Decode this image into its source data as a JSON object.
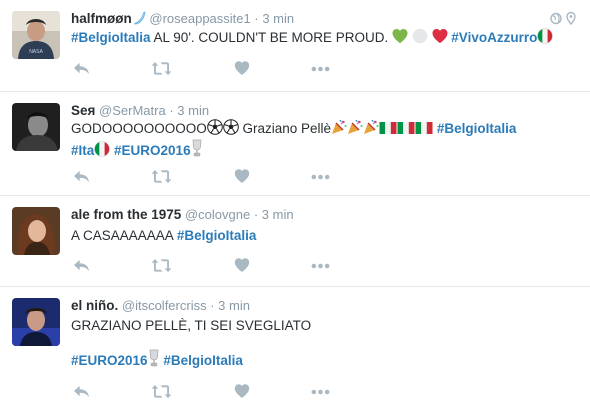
{
  "tweets": [
    {
      "name": "halfmøøn",
      "handle": "@roseappassite1",
      "time": "3 min",
      "line1": {
        "tag1": "#BelgioItalia",
        "text1": " AL 90'. COULDN'T BE MORE PROUD. ",
        "tag2": "#VivoAzzurro"
      }
    },
    {
      "name": "Sея",
      "handle": "@SerMatra",
      "time": "3 min",
      "line1": {
        "text1": "GODOOOOOOOOOO",
        "text2": " Graziano Pellè",
        "tag1": "#BelgioItalia"
      },
      "line2": {
        "tag1": "#Ita",
        "tag2": "#EURO2016"
      }
    },
    {
      "name": "ale from the 1975",
      "handle": "@colovgne",
      "time": "3 min",
      "line1": {
        "text1": "A CASAAAAAAA ",
        "tag1": "#BelgioItalia"
      }
    },
    {
      "name": "el niño.",
      "handle": "@itscolfercriss",
      "time": "3 min",
      "line1": {
        "text1": "GRAZIANO PELLÈ, TI SEI SVEGLIATO"
      },
      "line2": {
        "tag1": "#EURO2016",
        "tag2": "#BelgioItalia"
      }
    }
  ],
  "colors": {
    "link": "#2b7bb9",
    "meta": "#8899a6",
    "icon": "#aab8c2",
    "border": "#e1e8ed"
  },
  "icons": [
    "reply-icon",
    "retweet-icon",
    "like-icon",
    "more-icon",
    "globe-icon",
    "location-pin-icon"
  ]
}
